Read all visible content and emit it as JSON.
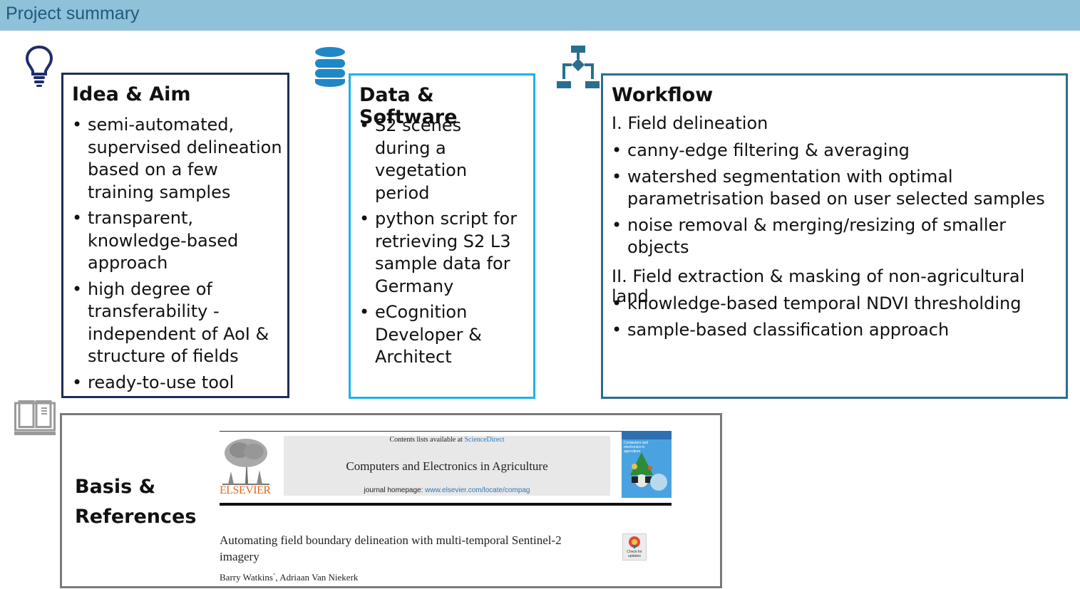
{
  "header": {
    "title": "Project summary"
  },
  "idea": {
    "title": "Idea & Aim",
    "items": [
      "semi-automated, supervised delineation based on a few training samples",
      "transparent, knowledge-based approach",
      "high degree of transferability - independent of AoI & structure of fields",
      "ready-to-use tool"
    ]
  },
  "data_software": {
    "title": "Data & Software",
    "items": [
      "S2 scenes during a vegetation period",
      "python script for retrieving S2 L3 sample data for Germany",
      "eCognition Developer & Architect"
    ]
  },
  "workflow": {
    "title": "Workflow",
    "section1": "I.  Field delineation",
    "section1_items": [
      "canny-edge filtering & averaging",
      "watershed segmentation with optimal parametrisation based on user selected samples",
      "noise removal & merging/resizing of smaller objects"
    ],
    "section2": "II. Field extraction & masking of non-agricultural land",
    "section2_items": [
      "knowledge-based temporal NDVI thresholding",
      "sample-based classification approach"
    ]
  },
  "references": {
    "title_line1": "Basis &",
    "title_line2": "References",
    "contents_prefix": "Contents lists available at ",
    "contents_link": "ScienceDirect",
    "journal_name": "Computers and Electronics in Agriculture",
    "homepage_prefix": "journal homepage: ",
    "homepage_url": "www.elsevier.com/locate/compag",
    "publisher": "ELSEVIER",
    "article_title_line1": "Automating field boundary delineation with multi-temporal Sentinel-2",
    "article_title_line2": "imagery",
    "authors": "Barry Watkins",
    "authors_mark": "*",
    "authors_rest": ", Adriaan Van Niekerk",
    "check_label_1": "Check for",
    "check_label_2": "updates",
    "cover_text": "Computers and electronics in agriculture"
  },
  "colors": {
    "header_bg": "#8fc1d8",
    "idea_border": "#1d2d5a",
    "data_border": "#20b0e8",
    "workflow_border": "#2a6e8e",
    "refs_border": "#7a7a7a",
    "icon_blue": "#1e87c8"
  },
  "icons": [
    "lightbulb-icon",
    "database-icon",
    "workflow-icon",
    "book-icon"
  ]
}
